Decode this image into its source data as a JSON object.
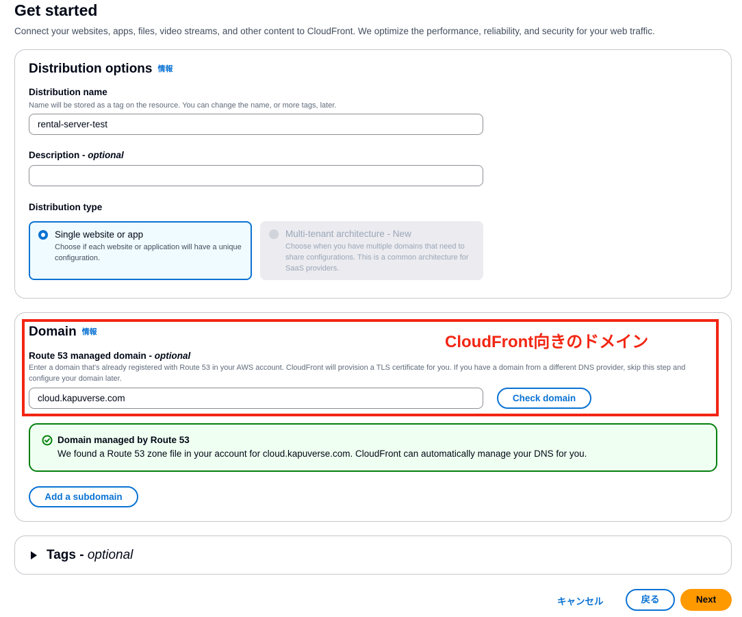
{
  "header": {
    "title": "Get started",
    "subtitle": "Connect your websites, apps, files, video streams, and other content to CloudFront. We optimize the performance, reliability, and security for your web traffic."
  },
  "distribution_options": {
    "heading": "Distribution options",
    "info": "情報",
    "name_label": "Distribution name",
    "name_desc": "Name will be stored as a tag on the resource. You can change the name, or more tags, later.",
    "name_value": "rental-server-test",
    "description_label": "Description - ",
    "description_optional": "optional",
    "description_value": "",
    "type_label": "Distribution type",
    "options": [
      {
        "title": "Single website or app",
        "desc": "Choose if each website or application will have a unique configuration.",
        "selected": true,
        "disabled": false
      },
      {
        "title": "Multi-tenant architecture - New",
        "desc": "Choose when you have multiple domains that need to share configurations. This is a common architecture for SaaS providers.",
        "selected": false,
        "disabled": true
      }
    ]
  },
  "domain": {
    "heading": "Domain",
    "info": "情報",
    "annotation": "CloudFront向きのドメイン",
    "route53_label": "Route 53 managed domain - ",
    "route53_optional": "optional",
    "route53_desc": "Enter a domain that's already registered with Route 53 in your AWS account. CloudFront will provision a TLS certificate for you. If you have a domain from a different DNS provider, skip this step and configure your domain later.",
    "domain_value": "cloud.kapuverse.com",
    "check_button": "Check domain",
    "alert_title": "Domain managed by Route 53",
    "alert_body": "We found a Route 53 zone file in your account for cloud.kapuverse.com. CloudFront can automatically manage your DNS for you.",
    "add_subdomain_button": "Add a subdomain"
  },
  "tags": {
    "label": "Tags - ",
    "optional": "optional"
  },
  "footer": {
    "cancel": "キャンセル",
    "back": "戻る",
    "next": "Next"
  },
  "colors": {
    "accent": "#0972d3",
    "primary_button": "#ff9900",
    "success": "#037f0c",
    "annotation": "#f22613"
  }
}
